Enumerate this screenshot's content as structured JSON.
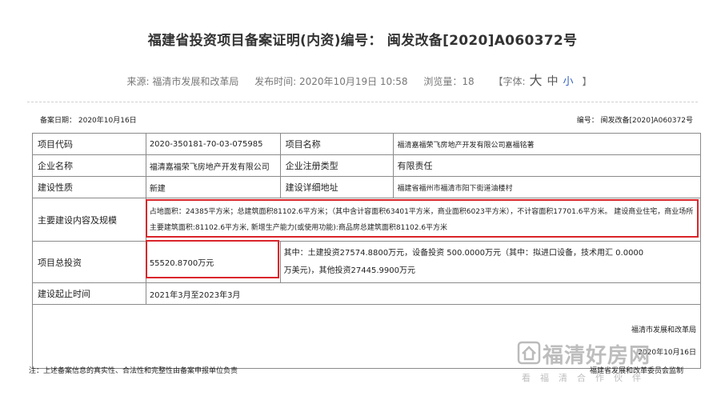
{
  "article": {
    "title": "福建省投资项目备案证明(内资)编号： 闽发改备[2020]A060372号",
    "source": "来源: 福清市发展和改革局",
    "publish_time": "发布时间: 2020年10月19日 10:58",
    "views": "浏览量：18",
    "font_size_label": "【字体:",
    "font_size_big": "大",
    "font_size_mid": "中",
    "font_size_small": "小",
    "font_size_close": "】"
  },
  "document": {
    "record_date": "备案日期： 2020年10月16日",
    "record_no": "编号： 闽发改备[2020]A060372号",
    "rows": {
      "project_code_label": "项目代码",
      "project_code": "2020-350181-70-03-075985",
      "project_name_label": "项目名称",
      "project_name": "福清嘉福荣飞房地产开发有限公司嘉福铭著",
      "company_label": "企业名称",
      "company": "福清嘉福荣飞房地产开发有限公司",
      "reg_type_label": "企业注册类型",
      "reg_type": "有限责任",
      "nature_label": "建设性质",
      "nature": "新建",
      "address_label": "建设详细地址",
      "address": "福建省福州市福清市阳下街道油楼村",
      "scope_label": "主要建设内容及规模",
      "scope_line1": "占地面积：24385平方米；总建筑面积81102.6平方米；（其中含计容面积63401平方米，商业面积6023平方米），不计容面积17701.6平方米。 建设商业住宅，商业场所",
      "scope_line2": "主要建筑面积:81102.6平方米, 新增生产能力(或使用功能):商品房总建筑面积81102.6平方米",
      "investment_label": "项目总投资",
      "investment_total": "55520.8700万元",
      "investment_detail1": "其中：土建投资27574.8800万元，设备投资 500.0000万元（其中：拟进口设备，技术用汇 0.0000",
      "investment_detail2": "万美元)，其他投资27445.9900万元",
      "period_label": "建设起止时间",
      "period": "2021年3月至2023年3月"
    },
    "issuer": "福清市发展和改革局",
    "issue_date": "2020年10月16日",
    "supervision": "福建省发展和改革委员会监制",
    "note": "注：上述备案信息的真实性、合法性和完整性由备案申报单位负责"
  },
  "watermark": {
    "main": "福清好房网",
    "sub": "看福清合作伙伴"
  },
  "colors": {
    "highlight": "#d9252b",
    "font_small_link": "#3560c0"
  }
}
